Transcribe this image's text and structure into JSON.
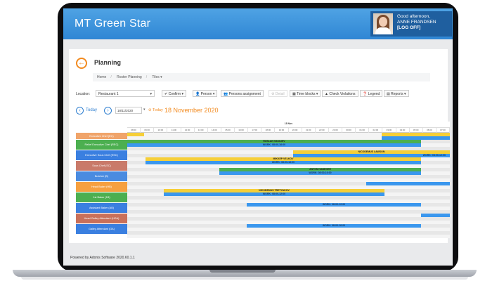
{
  "app": {
    "title": "MT Green Star"
  },
  "user": {
    "greeting": "Good afternoon,",
    "name": "ANNE FRANDSEN",
    "logoff": "[LOG OFF]"
  },
  "page": {
    "title": "Planning",
    "breadcrumb": [
      "Home",
      "Roster Planning",
      "Tiles ▾"
    ]
  },
  "toolbar": {
    "location_label": "Location:",
    "location_value": "Restaurant 1",
    "buttons": [
      {
        "label": "✔ Confirm ▾",
        "disabled": false
      },
      {
        "label": "👤 Person ▾",
        "disabled": false
      },
      {
        "label": "👥 Persons assignment",
        "disabled": false
      },
      {
        "label": "⚙ Detail",
        "disabled": true
      },
      {
        "label": "▦ Time blocks ▾",
        "disabled": false
      },
      {
        "label": "▲ Check Violations",
        "disabled": false
      },
      {
        "label": "❓ Legend",
        "disabled": false
      },
      {
        "label": "▤ Reports ▾",
        "disabled": false
      }
    ]
  },
  "datebar": {
    "prev_icon": "‹",
    "today_label": "Today",
    "next_icon": "›",
    "date_value": "18/11/2020",
    "today_link": "⊘ Today",
    "date_title": "18 November 2020"
  },
  "grid": {
    "day_label": "18 Nov",
    "hours": [
      "08:00",
      "09:00",
      "10:00",
      "11:00",
      "12:00",
      "13:00",
      "14:00",
      "15:00",
      "16:00",
      "17:00",
      "18:00",
      "19:00",
      "20:00",
      "21:00",
      "22:00",
      "23:00",
      "00:00",
      "01:00",
      "02:00",
      "03:00",
      "04:00",
      "05:00",
      "06:00",
      "07:00"
    ],
    "roles": [
      {
        "label": "Executive Chef (EC)",
        "color": "#f0a46a"
      },
      {
        "label": "Relief Executive Chef (REC)",
        "color": "#4caf50"
      },
      {
        "label": "Executive Sous Chef (ESC)",
        "color": "#3a7fe0"
      },
      {
        "label": "Sous Chef (SC)",
        "color": "#c97a6a"
      },
      {
        "label": "Butcher (B)",
        "color": "#4a8be0"
      },
      {
        "label": "Head Baker (HB)",
        "color": "#f6a040"
      },
      {
        "label": "1st Baker (1B)",
        "color": "#4caf50"
      },
      {
        "label": "Assistant Baker (AB)",
        "color": "#3a7fe0"
      },
      {
        "label": "Head Galley Attendant (HGA)",
        "color": "#c9705a"
      },
      {
        "label": "Galley Attendant (GA)",
        "color": "#3a7fe0"
      }
    ],
    "shifts": [
      {
        "name": "RUSLAN VASILIEV",
        "work": "WORK: 08:00-16:00"
      },
      {
        "name": "NICODEMUS LAWSON",
        "work": "WORK: 08:00-12:00"
      },
      {
        "name": "MIKKEP VELKOV",
        "work": "WORK: 08:00-16:00"
      },
      {
        "name": "ANTON HABEGER",
        "work": "WORK: 08:00-16:00"
      },
      {
        "name": "NICODEMUS TRETYAKOV",
        "work": "WORK: 08:00-12:00"
      },
      {
        "name": "",
        "work": "WORK: 08:00-12:00"
      },
      {
        "name": "",
        "work": "WORK: 08:00-16:00"
      }
    ]
  },
  "footer": {
    "text": "Powered by Adonis Software 2020.60.1.1"
  }
}
